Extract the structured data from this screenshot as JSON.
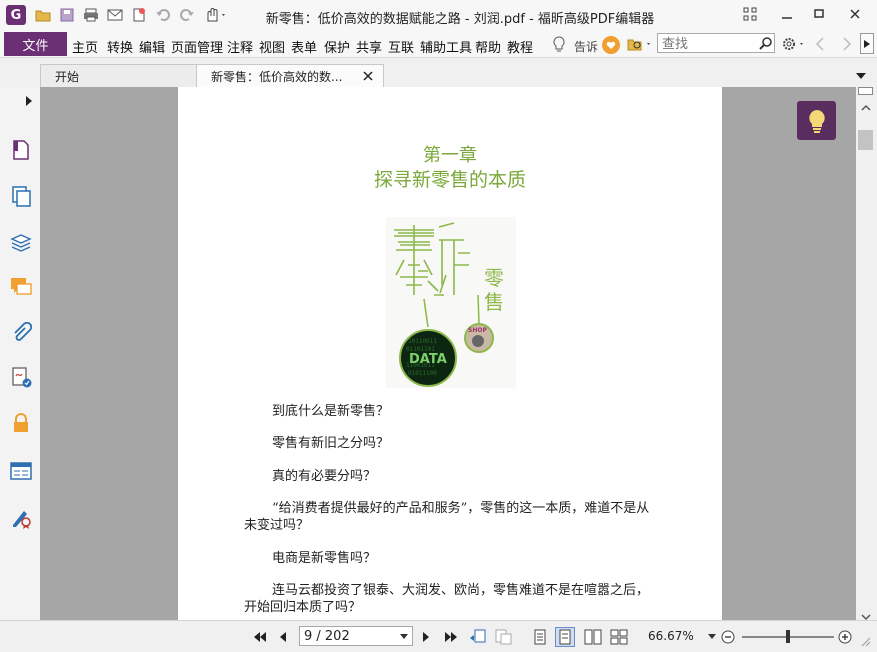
{
  "window": {
    "title": "新零售：低价高效的数据赋能之路 - 刘润.pdf - 福昕高级PDF编辑器",
    "app_icon": "foxit-logo",
    "accent": "#6b2f73"
  },
  "menu": {
    "file": "文件",
    "items": [
      "主页",
      "转换",
      "编辑",
      "页面管理",
      "注释",
      "视图",
      "表单",
      "保护",
      "共享",
      "互联",
      "辅助工具",
      "帮助",
      "教程"
    ],
    "tell_me": "告诉",
    "search_placeholder": "查找"
  },
  "tabs": [
    {
      "label": "开始",
      "active": false
    },
    {
      "label": "新零售：低价高效的数...",
      "active": true
    }
  ],
  "document": {
    "chapter": "第一章",
    "chapter_title": "探寻新零售的本质",
    "image_text_data": "DATA",
    "image_text_shop": "SHOP",
    "image_side_text": "零售",
    "paragraphs": [
      "到底什么是新零售？",
      "零售有新旧之分吗？",
      "真的有必要分吗？",
      "“给消费者提供最好的产品和服务”，零售的这一本质，难道不是从未变过吗？",
      "电商是新零售吗？",
      "连马云都投资了银泰、大润发、欧尚，零售难道不是在喧嚣之后，开始回归本质了吗？"
    ]
  },
  "status": {
    "page_indicator": "9 / 202",
    "zoom": "66.67%",
    "zoom_slider": 0.5
  }
}
